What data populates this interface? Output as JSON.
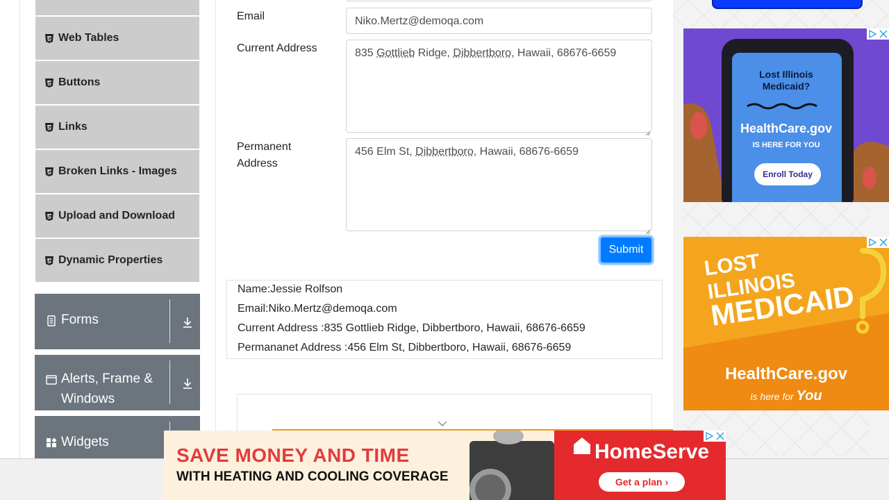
{
  "sidebar": {
    "items": [
      {
        "label": ""
      },
      {
        "label": "Web Tables"
      },
      {
        "label": "Buttons"
      },
      {
        "label": "Links"
      },
      {
        "label": "Broken Links - Images"
      },
      {
        "label": "Upload and Download"
      },
      {
        "label": "Dynamic Properties"
      }
    ],
    "groups": [
      {
        "label": "Forms"
      },
      {
        "label": "Alerts, Frame &",
        "label2": "Windows"
      },
      {
        "label": "Widgets"
      }
    ]
  },
  "form": {
    "email_label": "Email",
    "email_value": "Niko.Mertz@demoqa.com",
    "current_address_label": "Current Address",
    "current_address_parts": [
      "835 ",
      "Gottlieb",
      " Ridge, ",
      "Dibbertboro",
      ", Hawaii, 68676-6659"
    ],
    "permanent_address_label_1": "Permanent",
    "permanent_address_label_2": "Address",
    "permanent_address_parts": [
      "456 Elm St, ",
      "Dibbertboro",
      ", Hawaii, 68676-6659"
    ],
    "submit_label": "Submit"
  },
  "output": {
    "name": "Name:Jessie Rolfson",
    "email": "Email:Niko.Mertz@demoqa.com",
    "current_address": "Current Address :835 Gottlieb Ridge, Dibbertboro, Hawaii, 68676-6659",
    "permanent_address": "Permananet Address :456 Elm St, Dibbertboro, Hawaii, 68676-6659"
  },
  "ads": {
    "ad1": {
      "line1": "Lost Illinois",
      "line2": "Medicaid?",
      "brand": "HealthCare.gov",
      "tagline": "IS HERE FOR YOU",
      "cta": "Enroll Today"
    },
    "ad2": {
      "line1": "LOST",
      "line2": "ILLINOIS",
      "line3": "MEDICAID",
      "brand": "HealthCare.gov",
      "tagline_a": "is here for",
      "tagline_b": "You"
    },
    "bottom": {
      "line1": "SAVE MONEY AND TIME",
      "line2": "WITH HEATING AND COOLING COVERAGE",
      "brand": "HomeServe",
      "cta": "Get a plan ›"
    }
  },
  "colors": {
    "accent": "#007bff",
    "menu_bg": "#cccccc",
    "group_bg": "#6c757d"
  }
}
